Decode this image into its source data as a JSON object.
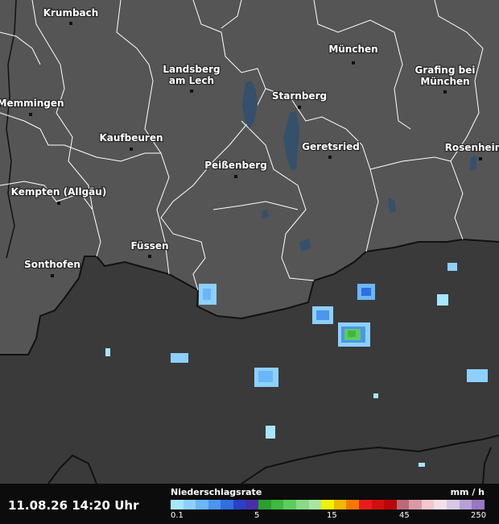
{
  "map": {
    "cities": [
      {
        "id": "krumbach",
        "name": "Krumbach"
      },
      {
        "id": "landsberg",
        "name": "Landsberg am Lech"
      },
      {
        "id": "muenchen",
        "name": "München"
      },
      {
        "id": "grafing",
        "name": "Grafing bei München"
      },
      {
        "id": "memmingen",
        "name": "Memmingen"
      },
      {
        "id": "starnberg",
        "name": "Starnberg"
      },
      {
        "id": "kaufbeuren",
        "name": "Kaufbeuren"
      },
      {
        "id": "geretsried",
        "name": "Geretsried"
      },
      {
        "id": "rosenheim",
        "name": "Rosenheim"
      },
      {
        "id": "peissenberg",
        "name": "Peißenberg"
      },
      {
        "id": "kempten",
        "name": "Kempten (Allgäu)"
      },
      {
        "id": "fuessen",
        "name": "Füssen"
      },
      {
        "id": "sonthofen",
        "name": "Sonthofen"
      }
    ],
    "colors": {
      "germany_land": "#555555",
      "outside_land": "#3a3a3a",
      "district_border": "#ffffff",
      "country_border": "#111111",
      "water": "#35506a"
    }
  },
  "footer": {
    "timestamp": "11.08.26 14:20 Uhr",
    "legend_title": "Niederschlagsrate",
    "legend_unit": "mm / h",
    "ticks": [
      "0.1",
      "5",
      "15",
      "45",
      "250"
    ],
    "legend_colors": [
      "#a6e6ff",
      "#8dd0ff",
      "#6ab7f7",
      "#4a96ee",
      "#2f6fe0",
      "#2c3fc6",
      "#4a2ea8",
      "#2ca02c",
      "#3fb83f",
      "#5ccd5c",
      "#86db86",
      "#a8e6a0",
      "#f2f200",
      "#f2b800",
      "#f27a00",
      "#e81c1c",
      "#d01010",
      "#b80808",
      "#b86a78",
      "#d99aa6",
      "#f2c8d0",
      "#f2e0e6",
      "#d8c8e8",
      "#b8a0d8",
      "#9878c0"
    ]
  }
}
